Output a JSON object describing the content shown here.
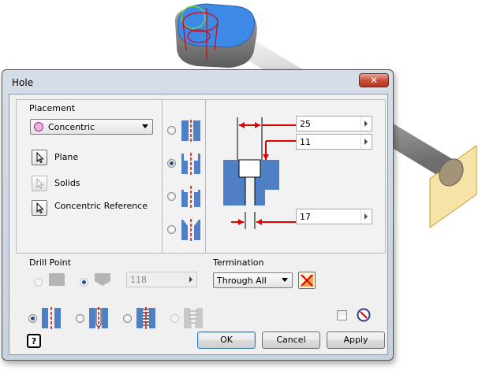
{
  "dialog": {
    "title": "Hole",
    "close_glyph": "✕"
  },
  "placement": {
    "heading": "Placement",
    "type_value": "Concentric",
    "plane_label": "Plane",
    "solids_label": "Solids",
    "concentric_ref_label": "Concentric Reference"
  },
  "hole_types": [
    "drilled",
    "counterbore",
    "spotface",
    "countersink"
  ],
  "hole_type_selected": "counterbore",
  "dimensions": {
    "counterbore_diameter": "25",
    "counterbore_depth": "11",
    "hole_diameter": "17"
  },
  "drill_point": {
    "heading": "Drill Point",
    "angle_value": "118"
  },
  "termination": {
    "heading": "Termination",
    "value": "Through All"
  },
  "thread_types": [
    "simple-hole",
    "clearance-hole",
    "tapped-hole",
    "taper-tapped-hole"
  ],
  "thread_type_selected": "simple-hole",
  "buttons": {
    "ok": "OK",
    "cancel": "Cancel",
    "apply": "Apply",
    "help_glyph": "?"
  },
  "colors": {
    "accent_red": "#e00000",
    "model_blue": "#3c8ae6",
    "section_blue": "#4f7fc4"
  }
}
